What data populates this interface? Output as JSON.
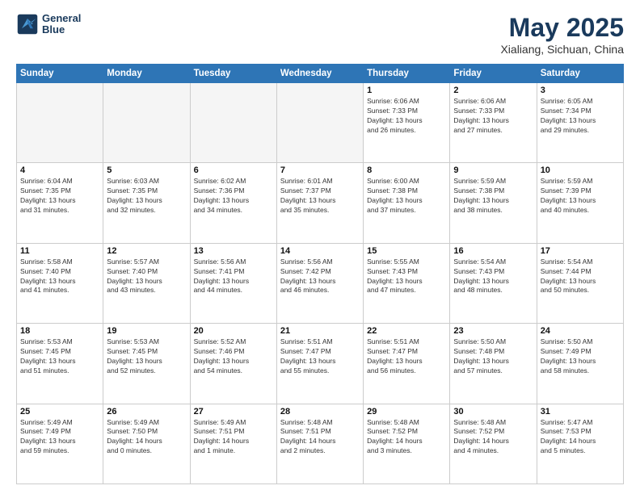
{
  "header": {
    "logo_line1": "General",
    "logo_line2": "Blue",
    "month": "May 2025",
    "location": "Xialiang, Sichuan, China"
  },
  "weekdays": [
    "Sunday",
    "Monday",
    "Tuesday",
    "Wednesday",
    "Thursday",
    "Friday",
    "Saturday"
  ],
  "weeks": [
    [
      {
        "day": "",
        "info": "",
        "empty": true
      },
      {
        "day": "",
        "info": "",
        "empty": true
      },
      {
        "day": "",
        "info": "",
        "empty": true
      },
      {
        "day": "",
        "info": "",
        "empty": true
      },
      {
        "day": "1",
        "info": "Sunrise: 6:06 AM\nSunset: 7:33 PM\nDaylight: 13 hours\nand 26 minutes.",
        "empty": false
      },
      {
        "day": "2",
        "info": "Sunrise: 6:06 AM\nSunset: 7:33 PM\nDaylight: 13 hours\nand 27 minutes.",
        "empty": false
      },
      {
        "day": "3",
        "info": "Sunrise: 6:05 AM\nSunset: 7:34 PM\nDaylight: 13 hours\nand 29 minutes.",
        "empty": false
      }
    ],
    [
      {
        "day": "4",
        "info": "Sunrise: 6:04 AM\nSunset: 7:35 PM\nDaylight: 13 hours\nand 31 minutes.",
        "empty": false
      },
      {
        "day": "5",
        "info": "Sunrise: 6:03 AM\nSunset: 7:35 PM\nDaylight: 13 hours\nand 32 minutes.",
        "empty": false
      },
      {
        "day": "6",
        "info": "Sunrise: 6:02 AM\nSunset: 7:36 PM\nDaylight: 13 hours\nand 34 minutes.",
        "empty": false
      },
      {
        "day": "7",
        "info": "Sunrise: 6:01 AM\nSunset: 7:37 PM\nDaylight: 13 hours\nand 35 minutes.",
        "empty": false
      },
      {
        "day": "8",
        "info": "Sunrise: 6:00 AM\nSunset: 7:38 PM\nDaylight: 13 hours\nand 37 minutes.",
        "empty": false
      },
      {
        "day": "9",
        "info": "Sunrise: 5:59 AM\nSunset: 7:38 PM\nDaylight: 13 hours\nand 38 minutes.",
        "empty": false
      },
      {
        "day": "10",
        "info": "Sunrise: 5:59 AM\nSunset: 7:39 PM\nDaylight: 13 hours\nand 40 minutes.",
        "empty": false
      }
    ],
    [
      {
        "day": "11",
        "info": "Sunrise: 5:58 AM\nSunset: 7:40 PM\nDaylight: 13 hours\nand 41 minutes.",
        "empty": false
      },
      {
        "day": "12",
        "info": "Sunrise: 5:57 AM\nSunset: 7:40 PM\nDaylight: 13 hours\nand 43 minutes.",
        "empty": false
      },
      {
        "day": "13",
        "info": "Sunrise: 5:56 AM\nSunset: 7:41 PM\nDaylight: 13 hours\nand 44 minutes.",
        "empty": false
      },
      {
        "day": "14",
        "info": "Sunrise: 5:56 AM\nSunset: 7:42 PM\nDaylight: 13 hours\nand 46 minutes.",
        "empty": false
      },
      {
        "day": "15",
        "info": "Sunrise: 5:55 AM\nSunset: 7:43 PM\nDaylight: 13 hours\nand 47 minutes.",
        "empty": false
      },
      {
        "day": "16",
        "info": "Sunrise: 5:54 AM\nSunset: 7:43 PM\nDaylight: 13 hours\nand 48 minutes.",
        "empty": false
      },
      {
        "day": "17",
        "info": "Sunrise: 5:54 AM\nSunset: 7:44 PM\nDaylight: 13 hours\nand 50 minutes.",
        "empty": false
      }
    ],
    [
      {
        "day": "18",
        "info": "Sunrise: 5:53 AM\nSunset: 7:45 PM\nDaylight: 13 hours\nand 51 minutes.",
        "empty": false
      },
      {
        "day": "19",
        "info": "Sunrise: 5:53 AM\nSunset: 7:45 PM\nDaylight: 13 hours\nand 52 minutes.",
        "empty": false
      },
      {
        "day": "20",
        "info": "Sunrise: 5:52 AM\nSunset: 7:46 PM\nDaylight: 13 hours\nand 54 minutes.",
        "empty": false
      },
      {
        "day": "21",
        "info": "Sunrise: 5:51 AM\nSunset: 7:47 PM\nDaylight: 13 hours\nand 55 minutes.",
        "empty": false
      },
      {
        "day": "22",
        "info": "Sunrise: 5:51 AM\nSunset: 7:47 PM\nDaylight: 13 hours\nand 56 minutes.",
        "empty": false
      },
      {
        "day": "23",
        "info": "Sunrise: 5:50 AM\nSunset: 7:48 PM\nDaylight: 13 hours\nand 57 minutes.",
        "empty": false
      },
      {
        "day": "24",
        "info": "Sunrise: 5:50 AM\nSunset: 7:49 PM\nDaylight: 13 hours\nand 58 minutes.",
        "empty": false
      }
    ],
    [
      {
        "day": "25",
        "info": "Sunrise: 5:49 AM\nSunset: 7:49 PM\nDaylight: 13 hours\nand 59 minutes.",
        "empty": false
      },
      {
        "day": "26",
        "info": "Sunrise: 5:49 AM\nSunset: 7:50 PM\nDaylight: 14 hours\nand 0 minutes.",
        "empty": false
      },
      {
        "day": "27",
        "info": "Sunrise: 5:49 AM\nSunset: 7:51 PM\nDaylight: 14 hours\nand 1 minute.",
        "empty": false
      },
      {
        "day": "28",
        "info": "Sunrise: 5:48 AM\nSunset: 7:51 PM\nDaylight: 14 hours\nand 2 minutes.",
        "empty": false
      },
      {
        "day": "29",
        "info": "Sunrise: 5:48 AM\nSunset: 7:52 PM\nDaylight: 14 hours\nand 3 minutes.",
        "empty": false
      },
      {
        "day": "30",
        "info": "Sunrise: 5:48 AM\nSunset: 7:52 PM\nDaylight: 14 hours\nand 4 minutes.",
        "empty": false
      },
      {
        "day": "31",
        "info": "Sunrise: 5:47 AM\nSunset: 7:53 PM\nDaylight: 14 hours\nand 5 minutes.",
        "empty": false
      }
    ]
  ]
}
